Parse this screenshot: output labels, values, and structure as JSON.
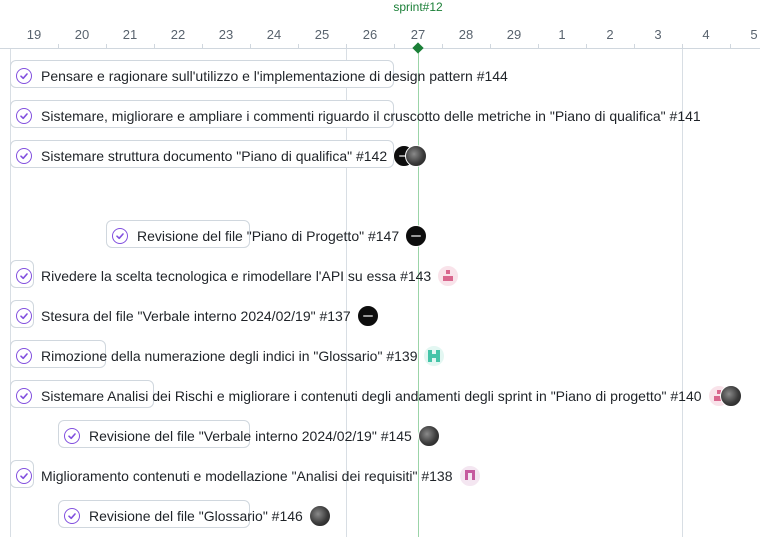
{
  "timeline": {
    "sprint_label": "sprint#12",
    "days": [
      "19",
      "20",
      "21",
      "22",
      "23",
      "24",
      "25",
      "26",
      "27",
      "28",
      "29",
      "1",
      "2",
      "3",
      "4",
      "5"
    ]
  },
  "items": [
    {
      "title": "Pensare e ragionare sull'utilizzo e l'implementazione di design pattern #144",
      "status": "completed",
      "avatars": []
    },
    {
      "title": "Sistemare, migliorare e ampliare i commenti riguardo il cruscotto delle metriche in \"Piano di qualifica\" #141",
      "status": "completed",
      "avatars": []
    },
    {
      "title": "Sistemare struttura documento \"Piano di qualifica\" #142",
      "status": "completed",
      "avatars": [
        "dark-avatar",
        "photo-avatar"
      ]
    },
    {
      "title": "Revisione del file \"Piano di Progetto\" #147",
      "status": "completed",
      "avatars": [
        "dark-avatar"
      ]
    },
    {
      "title": "Rivedere la scelta tecnologica e rimodellare l'API su essa #143",
      "status": "completed",
      "avatars": [
        "pink-identicon"
      ]
    },
    {
      "title": "Stesura del file \"Verbale interno 2024/02/19\" #137",
      "status": "completed",
      "avatars": [
        "dark-avatar"
      ]
    },
    {
      "title": "Rimozione della numerazione degli indici in \"Glossario\" #139",
      "status": "completed",
      "avatars": [
        "teal-identicon"
      ]
    },
    {
      "title": "Sistemare Analisi dei Rischi e migliorare i contenuti degli andamenti degli sprint in \"Piano di progetto\" #140",
      "status": "completed",
      "avatars": [
        "pink-identicon",
        "photo-avatar"
      ]
    },
    {
      "title": "Revisione del file \"Verbale interno 2024/02/19\" #145",
      "status": "completed",
      "avatars": [
        "photo-avatar"
      ]
    },
    {
      "title": "Miglioramento contenuti e modellazione \"Analisi dei requisiti\" #138",
      "status": "completed",
      "avatars": [
        "purple-identicon"
      ]
    },
    {
      "title": "Revisione del file \"Glossario\" #146",
      "status": "completed",
      "avatars": [
        "photo-avatar"
      ]
    }
  ],
  "colors": {
    "accent": "#1a7f37",
    "completed_icon": "#8250df",
    "border": "#d0d7de"
  }
}
